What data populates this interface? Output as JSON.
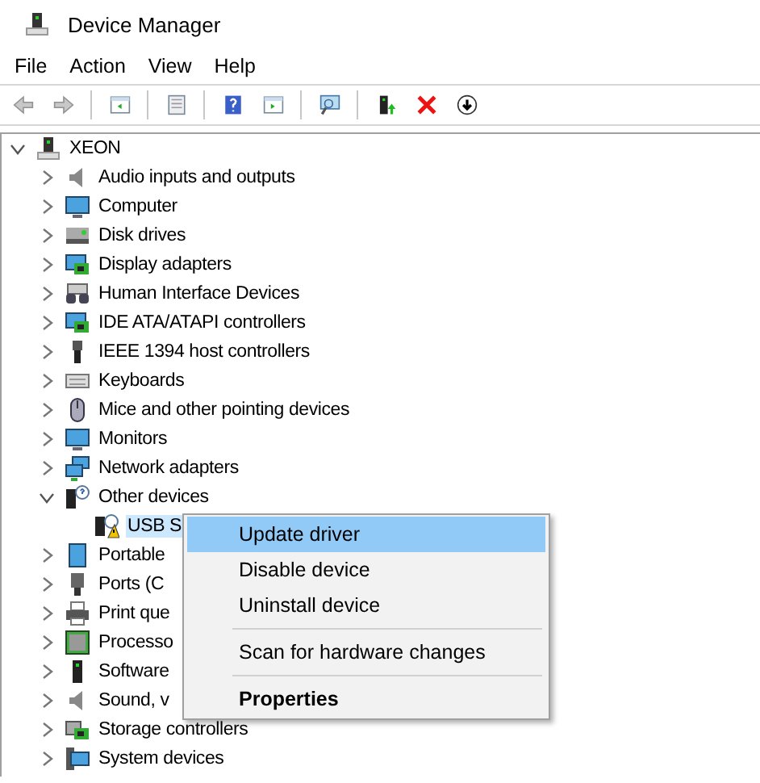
{
  "window": {
    "title": "Device Manager"
  },
  "menu_bar": [
    "File",
    "Action",
    "View",
    "Help"
  ],
  "toolbar": [
    {
      "kind": "back",
      "disabled": true
    },
    {
      "kind": "forward",
      "disabled": true
    },
    {
      "kind": "sep"
    },
    {
      "kind": "console",
      "disabled": false
    },
    {
      "kind": "sep"
    },
    {
      "kind": "properties",
      "disabled": false
    },
    {
      "kind": "sep"
    },
    {
      "kind": "help",
      "disabled": false
    },
    {
      "kind": "panel",
      "disabled": false
    },
    {
      "kind": "sep"
    },
    {
      "kind": "scan",
      "disabled": false
    },
    {
      "kind": "sep"
    },
    {
      "kind": "update",
      "disabled": false
    },
    {
      "kind": "uninstall",
      "disabled": false
    },
    {
      "kind": "down",
      "disabled": false
    }
  ],
  "tree": {
    "label": "XEON",
    "kind": "computer",
    "expanded": true,
    "selected": false,
    "children": [
      {
        "label": "Audio inputs and outputs",
        "kind": "speaker",
        "expanded": false,
        "selected": false
      },
      {
        "label": "Computer",
        "kind": "monitor",
        "expanded": false,
        "selected": false
      },
      {
        "label": "Disk drives",
        "kind": "disk",
        "expanded": false,
        "selected": false
      },
      {
        "label": "Display adapters",
        "kind": "card",
        "expanded": false,
        "selected": false
      },
      {
        "label": "Human Interface Devices",
        "kind": "hid",
        "expanded": false,
        "selected": false
      },
      {
        "label": "IDE ATA/ATAPI controllers",
        "kind": "card",
        "expanded": false,
        "selected": false
      },
      {
        "label": "IEEE 1394 host controllers",
        "kind": "plug",
        "expanded": false,
        "selected": false
      },
      {
        "label": "Keyboards",
        "kind": "keyboard",
        "expanded": false,
        "selected": false
      },
      {
        "label": "Mice and other pointing devices",
        "kind": "mouse",
        "expanded": false,
        "selected": false
      },
      {
        "label": "Monitors",
        "kind": "monitor",
        "expanded": false,
        "selected": false
      },
      {
        "label": "Network adapters",
        "kind": "network",
        "expanded": false,
        "selected": false
      },
      {
        "label": "Other devices",
        "kind": "unknown",
        "expanded": true,
        "selected": false,
        "children": [
          {
            "label": "USB S",
            "kind": "warning",
            "selected": true
          }
        ]
      },
      {
        "label": "Portable",
        "kind": "portable",
        "expanded": false,
        "selected": false
      },
      {
        "label": "Ports (C",
        "kind": "port",
        "expanded": false,
        "selected": false
      },
      {
        "label": "Print que",
        "kind": "printer",
        "expanded": false,
        "selected": false
      },
      {
        "label": "Processo",
        "kind": "chip",
        "expanded": false,
        "selected": false
      },
      {
        "label": "Software",
        "kind": "tower",
        "expanded": false,
        "selected": false
      },
      {
        "label": "Sound, v",
        "kind": "speaker",
        "expanded": false,
        "selected": false
      },
      {
        "label": "Storage controllers",
        "kind": "storage",
        "expanded": false,
        "selected": false
      },
      {
        "label": "System devices",
        "kind": "system",
        "expanded": false,
        "selected": false
      }
    ]
  },
  "context_menu": [
    {
      "kind": "item",
      "label": "Update driver",
      "selected": true,
      "default": false
    },
    {
      "kind": "item",
      "label": "Disable device",
      "selected": false,
      "default": false
    },
    {
      "kind": "item",
      "label": "Uninstall device",
      "selected": false,
      "default": false
    },
    {
      "kind": "separator"
    },
    {
      "kind": "item",
      "label": "Scan for hardware changes",
      "selected": false,
      "default": false
    },
    {
      "kind": "separator"
    },
    {
      "kind": "item",
      "label": "Properties",
      "selected": false,
      "default": true
    }
  ]
}
